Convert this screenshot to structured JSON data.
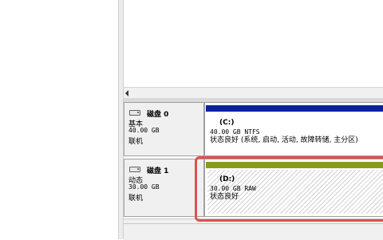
{
  "disks": [
    {
      "name": "磁盘 0",
      "type": "基本",
      "size": "40.00 GB",
      "state": "联机",
      "partition": {
        "label": "(C:)",
        "size_fs": "40.00 GB NTFS",
        "status": "状态良好 (系统, 启动, 活动, 故障转储, 主分区)",
        "bar_color": "#0a20a0"
      }
    },
    {
      "name": "磁盘 1",
      "type": "动态",
      "size": "30.00 GB",
      "state": "联机",
      "partition": {
        "label": "(D:)",
        "size_fs": "30.00 GB RAW",
        "status": "状态良好",
        "bar_color": "#8a9a1e"
      }
    }
  ],
  "highlight_color": "#e05050"
}
